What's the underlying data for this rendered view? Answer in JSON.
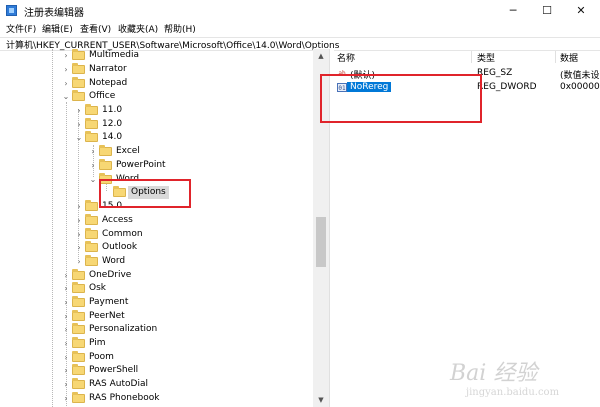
{
  "window": {
    "title": "注册表编辑器",
    "controls": {
      "minimize": "─",
      "maximize": "☐",
      "close": "✕"
    }
  },
  "menu": [
    "文件(F)",
    "编辑(E)",
    "查看(V)",
    "收藏夹(A)",
    "帮助(H)"
  ],
  "address": "计算机\\HKEY_CURRENT_USER\\Software\\Microsoft\\Office\\14.0\\Word\\Options",
  "tree": {
    "expand_glyph": "›",
    "collapse_glyph": "⌄",
    "items": [
      {
        "label": "Multimedia",
        "state": "collapsed"
      },
      {
        "label": "Narrator",
        "state": "collapsed"
      },
      {
        "label": "Notepad",
        "state": "collapsed"
      },
      {
        "label": "Office",
        "state": "expanded"
      },
      {
        "label": "11.0",
        "state": "collapsed"
      },
      {
        "label": "12.0",
        "state": "collapsed"
      },
      {
        "label": "14.0",
        "state": "expanded"
      },
      {
        "label": "Excel",
        "state": "collapsed"
      },
      {
        "label": "PowerPoint",
        "state": "collapsed"
      },
      {
        "label": "Word",
        "state": "expanded"
      },
      {
        "label": "Options",
        "state": "leaf",
        "selected": true
      },
      {
        "label": "15.0",
        "state": "collapsed"
      },
      {
        "label": "Access",
        "state": "collapsed"
      },
      {
        "label": "Common",
        "state": "collapsed"
      },
      {
        "label": "Outlook",
        "state": "collapsed"
      },
      {
        "label": "Word",
        "state": "collapsed"
      },
      {
        "label": "OneDrive",
        "state": "collapsed"
      },
      {
        "label": "Osk",
        "state": "collapsed"
      },
      {
        "label": "Payment",
        "state": "collapsed"
      },
      {
        "label": "PeerNet",
        "state": "collapsed"
      },
      {
        "label": "Personalization",
        "state": "collapsed"
      },
      {
        "label": "Pim",
        "state": "collapsed"
      },
      {
        "label": "Poom",
        "state": "collapsed"
      },
      {
        "label": "PowerShell",
        "state": "collapsed"
      },
      {
        "label": "RAS AutoDial",
        "state": "collapsed"
      },
      {
        "label": "RAS Phonebook",
        "state": "collapsed"
      }
    ]
  },
  "list": {
    "columns": [
      "名称",
      "类型",
      "数据"
    ],
    "rows": [
      {
        "icon": "string-value-icon",
        "icon_glyph": "ab",
        "name": "(默认)",
        "type": "REG_SZ",
        "data": "(数值未设"
      },
      {
        "icon": "dword-value-icon",
        "icon_glyph": "01",
        "name": "NoRereg",
        "type": "REG_DWORD",
        "data": "0x00000"
      }
    ]
  },
  "watermark": {
    "logo": "Bai 经验",
    "url": "jingyan.baidu.com"
  },
  "colors": {
    "selection": "#0078d7",
    "highlight_box": "#e0242b",
    "folder": "#f7d774"
  }
}
